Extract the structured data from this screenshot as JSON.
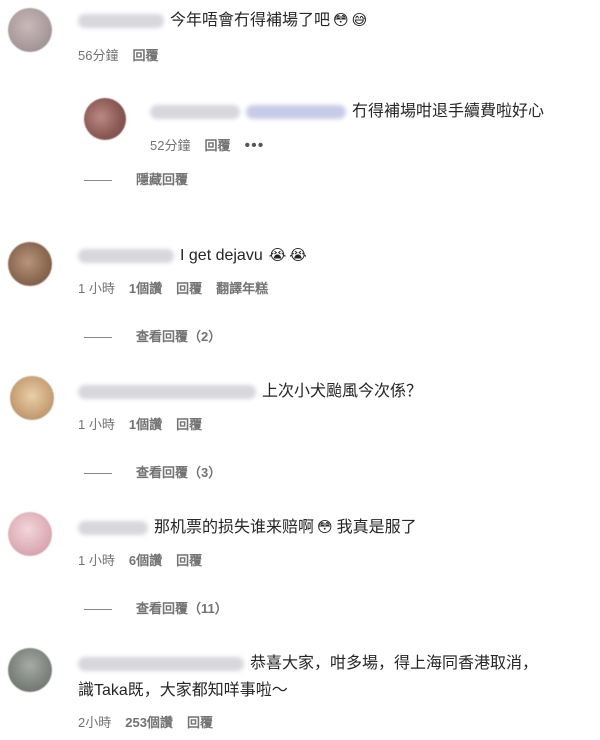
{
  "comments": [
    {
      "text": "今年唔會冇得補場了吧",
      "emojis": [
        "😳",
        "😅"
      ],
      "time": "56分鐘",
      "reply": "回覆"
    },
    {
      "text": "冇得補場咁退手續費啦好心",
      "time": "52分鐘",
      "reply": "回覆",
      "more": "•••",
      "hide_replies": "隱藏回覆"
    },
    {
      "text": "I get dejavu",
      "emojis": [
        "😭",
        "😭"
      ],
      "time": "1 小時",
      "likes": "1個讚",
      "reply": "回覆",
      "translate": "翻譯年糕",
      "view_replies": "查看回覆（2）"
    },
    {
      "text": "上次小犬颱風今次係？",
      "time": "1 小時",
      "likes": "1個讚",
      "reply": "回覆",
      "view_replies": "查看回覆（3）"
    },
    {
      "text": "那机票的损失谁来赔啊",
      "emoji": "😳",
      "text2": "我真是服了",
      "time": "1 小時",
      "likes": "6個讚",
      "reply": "回覆",
      "view_replies": "查看回覆（11）"
    },
    {
      "text": "恭喜大家，咁多場，得上海同香港取消，",
      "text_line2": "識Taka既，大家都知咩事啦～",
      "time": "2小時",
      "likes": "253個讚",
      "reply": "回覆"
    }
  ],
  "colors": {
    "text": "#262626",
    "meta": "#737373"
  }
}
